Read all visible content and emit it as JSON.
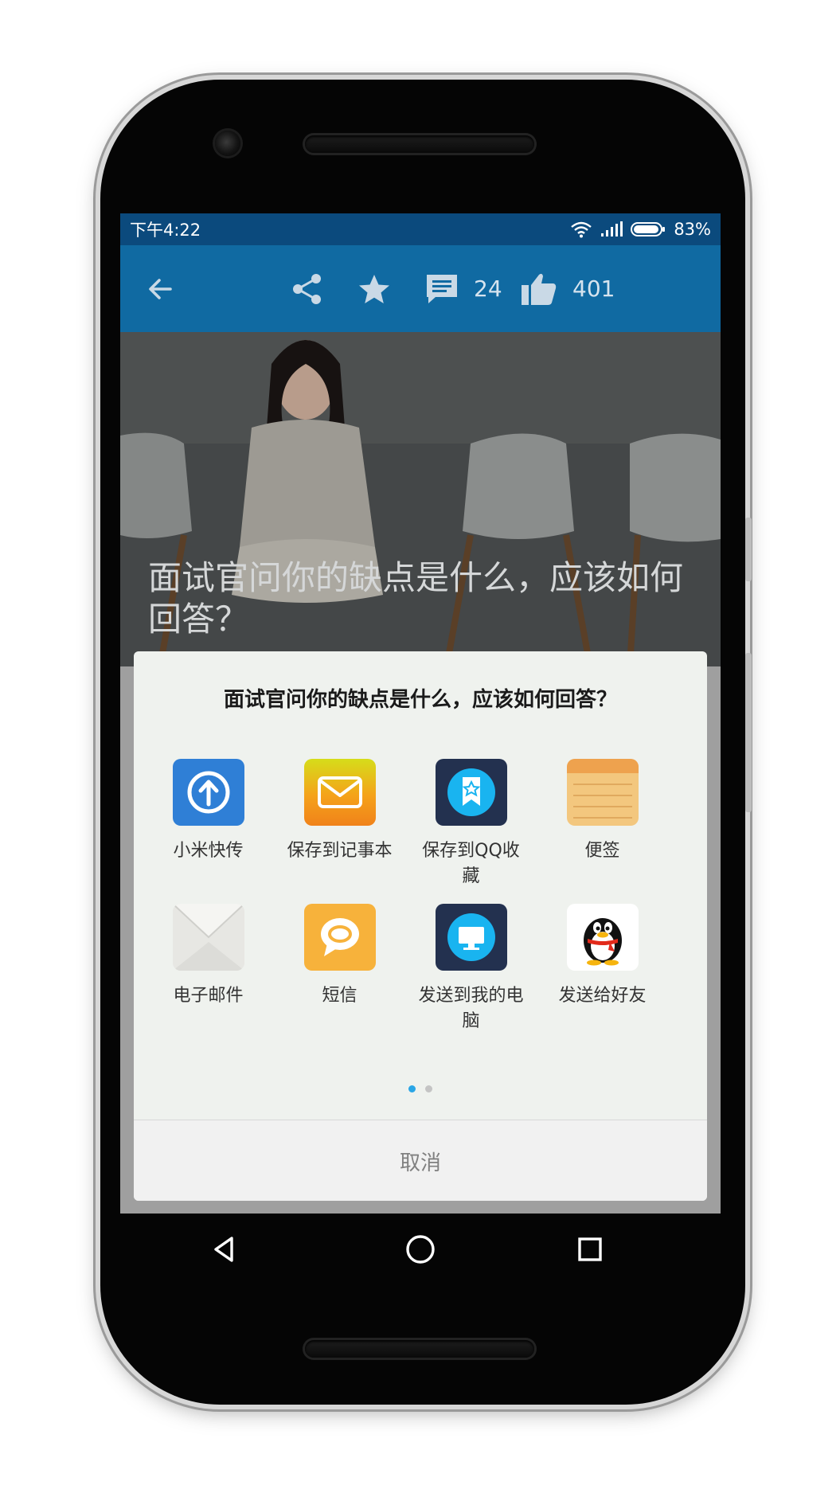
{
  "status_bar": {
    "time": "下午4:22",
    "battery": "83%",
    "wifi_icon": "wifi-icon",
    "signal_icon": "signal-icon",
    "battery_icon": "battery-icon"
  },
  "toolbar": {
    "back_icon": "back-arrow-icon",
    "share_icon": "share-icon",
    "favorite_icon": "star-icon",
    "comment_icon": "comment-icon",
    "comment_count": "24",
    "like_icon": "thumbs-up-icon",
    "like_count": "401"
  },
  "article": {
    "title": "面试官问你的缺点是什么，应该如何回答？"
  },
  "share_sheet": {
    "title": "面试官问你的缺点是什么，应该如何回答？",
    "items": [
      {
        "label": "小米快传",
        "icon": "mi-drop-icon",
        "color": "#2f7fd6"
      },
      {
        "label": "保存到记事本",
        "icon": "mail-note-icon",
        "color": "#f39c12"
      },
      {
        "label": "保存到QQ收藏",
        "icon": "qq-favorites-icon",
        "color": "#23314f"
      },
      {
        "label": "便签",
        "icon": "notepad-icon",
        "color": "#f3c77e"
      },
      {
        "label": "电子邮件",
        "icon": "email-icon",
        "color": "#e9e9e6"
      },
      {
        "label": "短信",
        "icon": "sms-icon",
        "color": "#f7b23b"
      },
      {
        "label": "发送到我的电脑",
        "icon": "computer-icon",
        "color": "#23314f"
      },
      {
        "label": "发送给好友",
        "icon": "qq-penguin-icon",
        "color": "#ffffff"
      }
    ],
    "page_indicator": {
      "pages": 2,
      "current": 1,
      "active_color": "#2aa6e6",
      "inactive_color": "#c4c4c4"
    },
    "cancel_label": "取消"
  },
  "nav_bar": {
    "back_icon": "nav-back-icon",
    "home_icon": "nav-home-icon",
    "recents_icon": "nav-recents-icon"
  }
}
